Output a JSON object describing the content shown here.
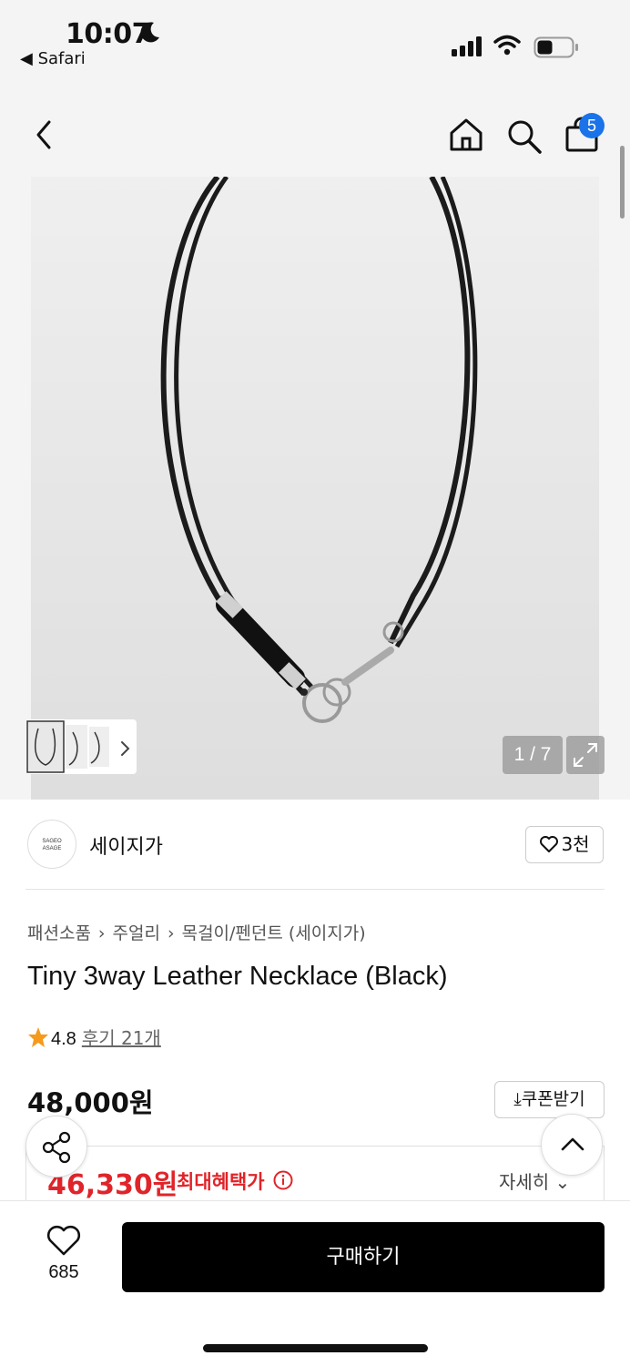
{
  "status_bar": {
    "time": "10:07",
    "back_app": "◀ Safari"
  },
  "nav": {
    "cart_count": "5"
  },
  "gallery": {
    "counter": "1 / 7"
  },
  "brand": {
    "logo_line1": "SAGEO",
    "logo_line2": "ASAGE",
    "name": "세이지가",
    "likes": "3천"
  },
  "breadcrumb": [
    "패션소품",
    "주얼리",
    "목걸이/펜던트 (세이지가)"
  ],
  "product": {
    "title": "Tiny 3way Leather Necklace (Black)",
    "rating": "4.8",
    "reviews": "후기 21개",
    "price": "48,000원",
    "coupon_label": "⤓쿠폰받기",
    "benefit_price": "46,330원",
    "benefit_label": "최대혜택가",
    "detail_label": "자세히 ⌄"
  },
  "bottom_bar": {
    "wish_count": "685",
    "buy_label": "구매하기"
  },
  "colors": {
    "accent_badge": "#1a73e8",
    "sale_red": "#e0242a",
    "star_orange": "#f59a1b",
    "buy_button": "#000000"
  }
}
